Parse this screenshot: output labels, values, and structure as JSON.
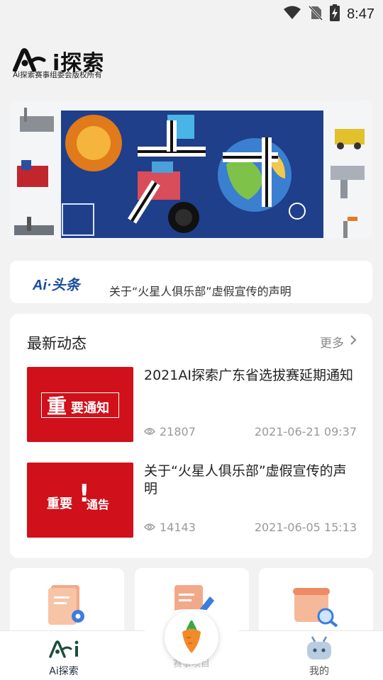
{
  "status_bar": {
    "time": "8:47"
  },
  "brand": {
    "logo_text": "i探索",
    "subtitle": "Ai探索赛事组委会版权所有"
  },
  "ticker": {
    "logo": "Ai·头条",
    "text": "关于“火星人俱乐部”虚假宣传的声明"
  },
  "latest": {
    "title": "最新动态",
    "more_label": "更多",
    "items": [
      {
        "title": "2021AI探索广东省选拔赛延期通知",
        "thumb_big": "重",
        "thumb_small": "要通知",
        "views": "21807",
        "date": "2021-06-21 09:37"
      },
      {
        "title": "关于“火星人俱乐部”虚假宣传的声明",
        "thumb_left": "重要",
        "thumb_mark": "!",
        "thumb_right": "通告",
        "views": "14143",
        "date": "2021-06-05 15:13"
      }
    ]
  },
  "tabbar": {
    "home_label": "Ai探索",
    "center_label": "赛事项目",
    "me_label": "我的"
  },
  "colors": {
    "accent_red": "#d0101a",
    "brand_blue": "#1c4d9c"
  }
}
